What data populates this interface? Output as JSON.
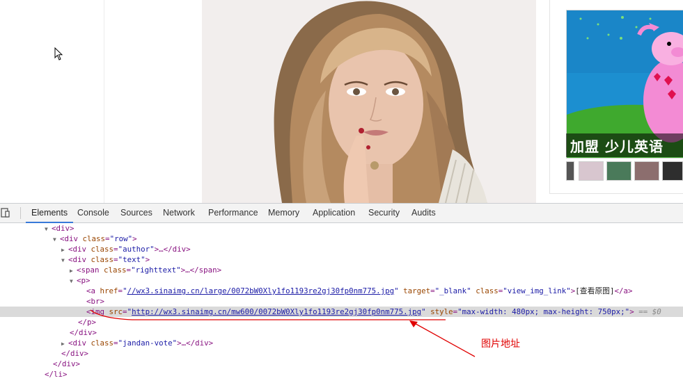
{
  "page": {
    "ad_caption": "加盟 少儿英语"
  },
  "devtools": {
    "tabs": [
      "Elements",
      "Console",
      "Sources",
      "Network",
      "Performance",
      "Memory",
      "Application",
      "Security",
      "Audits"
    ],
    "active_tab": "Elements",
    "dom": {
      "l1_tag": "<div>",
      "l2_open": "<div",
      "l2_attr": "class",
      "l2_val": "\"row\"",
      "l2_close": ">",
      "l3_open": "<div",
      "l3_attr": "class",
      "l3_val": "\"author\"",
      "l3_close": ">…</div>",
      "l4_open": "<div",
      "l4_attr": "class",
      "l4_val": "\"text\"",
      "l4_close": ">",
      "l5_open": "<span",
      "l5_attr": "class",
      "l5_val": "\"righttext\"",
      "l5_close": ">…</span>",
      "l6_tag": "<p>",
      "l7_open": "<a",
      "l7_attr1": "href",
      "l7_val1": "//wx3.sinaimg.cn/large/0072bW0Xly1fo1193re2gj30fp0nm775.jpg",
      "l7_attr2": "target",
      "l7_val2": "\"_blank\"",
      "l7_attr3": "class",
      "l7_val3": "\"view_img_link\"",
      "l7_text": "[查看原图]",
      "l7_close": "</a>",
      "l8_tag": "<br>",
      "l9_open": "<img",
      "l9_attr1": "src",
      "l9_val1": "http://wx3.sinaimg.cn/mw600/0072bW0Xly1fo1193re2gj30fp0nm775.jpg",
      "l9_attr2": "style",
      "l9_val2": "\"max-width: 480px; max-height: 750px;\"",
      "l9_close": ">",
      "l9_eq": "== $0",
      "l10_tag": "</p>",
      "l11_tag": "</div>",
      "l12_open": "<div",
      "l12_attr": "class",
      "l12_val": "\"jandan-vote\"",
      "l12_close": ">…</div>",
      "l13_tag": "</div>",
      "l14_tag": "</div>",
      "l15_tag": "</li>"
    }
  },
  "annotation": {
    "label": "图片地址",
    "color": "#e00000"
  },
  "colors": {
    "tag": "#881280",
    "attr": "#994500",
    "value": "#1a1aa6",
    "active_tab_underline": "#3879d9"
  }
}
